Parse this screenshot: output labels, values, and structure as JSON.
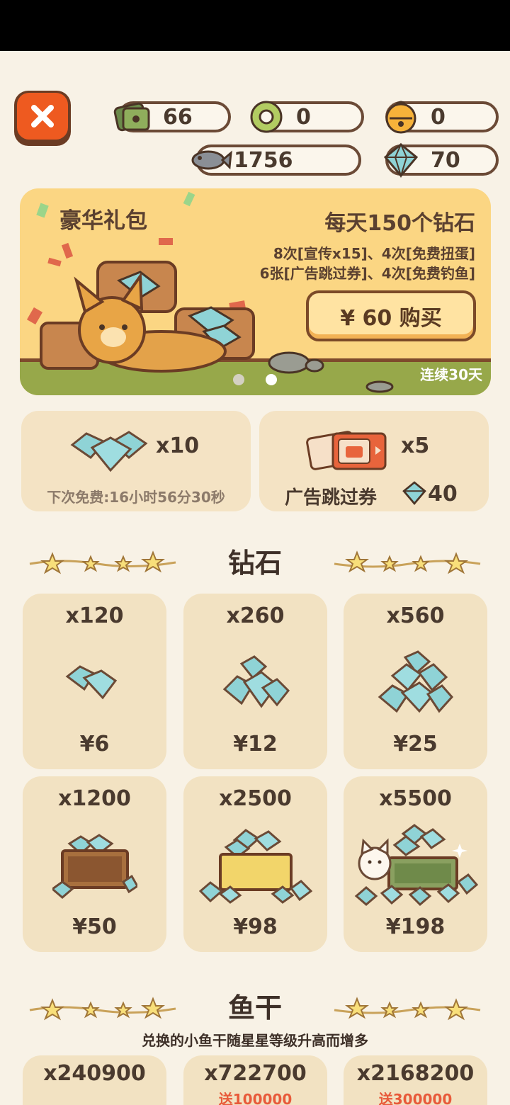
{
  "currencies": {
    "tickets": "66",
    "tokens": "0",
    "bells": "0",
    "fish": "1756",
    "diamonds": "70"
  },
  "banner": {
    "title": "豪华礼包",
    "headline": "每天150个钻石",
    "line1": "8次[宣传x15]、4次[免费扭蛋]",
    "line2": "6张[广告跳过券]、4次[免费钓鱼]",
    "buy_label": "¥ 60 购买",
    "days": "连续30天"
  },
  "free_diamond": {
    "amount": "x10",
    "next_free": "下次免费:16小时56分30秒"
  },
  "ad_skip": {
    "amount": "x5",
    "label": "广告跳过券",
    "price": "40"
  },
  "diamond_section": {
    "title": "钻石",
    "items": [
      {
        "amount": "x120",
        "price": "¥6"
      },
      {
        "amount": "x260",
        "price": "¥12"
      },
      {
        "amount": "x560",
        "price": "¥25"
      },
      {
        "amount": "x1200",
        "price": "¥50"
      },
      {
        "amount": "x2500",
        "price": "¥98"
      },
      {
        "amount": "x5500",
        "price": "¥198"
      }
    ]
  },
  "fish_section": {
    "title": "鱼干",
    "subtitle": "兑换的小鱼干随星星等级升高而增多",
    "items": [
      {
        "amount": "x240900",
        "bonus": ""
      },
      {
        "amount": "x722700",
        "bonus": "送100000"
      },
      {
        "amount": "x2168200",
        "bonus": "送300000"
      }
    ]
  },
  "colors": {
    "background": "#f8f2e6",
    "card": "#f2e2c2",
    "banner": "#fbd683",
    "close_button": "#ee5a20",
    "gem": "#8fd3d6",
    "bonus_text": "#e85a3a"
  },
  "icons": {
    "close": "close-icon",
    "tickets": "ticket-stack-icon",
    "tokens": "token-ring-icon",
    "bells": "bell-icon",
    "fish": "fish-icon",
    "diamonds": "diamond-icon"
  }
}
